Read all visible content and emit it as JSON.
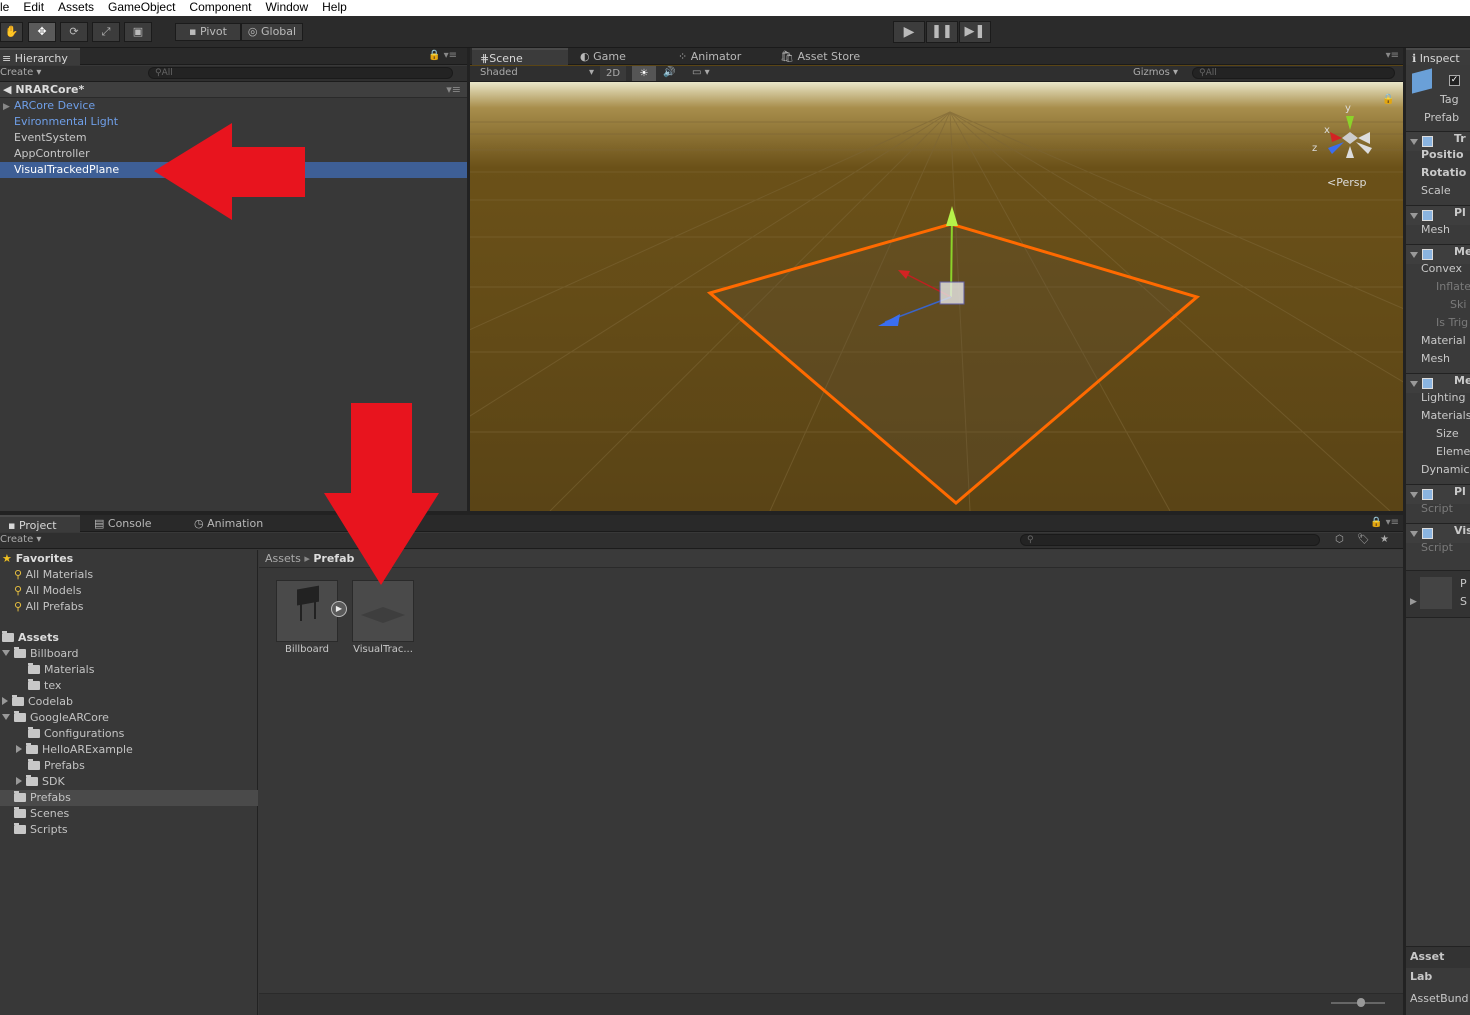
{
  "menu": [
    "le",
    "Edit",
    "Assets",
    "GameObject",
    "Component",
    "Window",
    "Help"
  ],
  "toolbar": {
    "pivot": "Pivot",
    "global": "Global"
  },
  "hierarchy": {
    "tab": "Hierarchy",
    "create": "Create",
    "search": "All",
    "scene": "NRARCore*",
    "items": [
      {
        "label": "ARCore Device",
        "prefab": true,
        "expand": true
      },
      {
        "label": "Evironmental Light",
        "prefab": true,
        "expand": false
      },
      {
        "label": "EventSystem",
        "prefab": false,
        "expand": false
      },
      {
        "label": "AppController",
        "prefab": false,
        "expand": false
      },
      {
        "label": "VisualTrackedPlane",
        "prefab": false,
        "expand": false,
        "selected": true
      }
    ]
  },
  "scene": {
    "tabs": [
      "Scene",
      "Game",
      "Animator",
      "Asset Store"
    ],
    "shading": "Shaded",
    "mode2d": "2D",
    "gizmos": "Gizmos",
    "search": "All",
    "persp": "Persp",
    "axis": {
      "x": "x",
      "y": "y",
      "z": "z"
    }
  },
  "project": {
    "tabs": [
      "Project",
      "Console",
      "Animation"
    ],
    "create": "Create",
    "favorites_title": "Favorites",
    "favorites": [
      "All Materials",
      "All Models",
      "All Prefabs"
    ],
    "assets_title": "Assets",
    "tree": [
      {
        "label": "Billboard",
        "indent": 1,
        "arrow": "down"
      },
      {
        "label": "Materials",
        "indent": 2,
        "arrow": ""
      },
      {
        "label": "tex",
        "indent": 2,
        "arrow": ""
      },
      {
        "label": "Codelab",
        "indent": 1,
        "arrow": "right"
      },
      {
        "label": "GoogleARCore",
        "indent": 1,
        "arrow": "down"
      },
      {
        "label": "Configurations",
        "indent": 2,
        "arrow": ""
      },
      {
        "label": "HelloARExample",
        "indent": 2,
        "arrow": "right"
      },
      {
        "label": "Prefabs",
        "indent": 2,
        "arrow": ""
      },
      {
        "label": "SDK",
        "indent": 2,
        "arrow": "right"
      },
      {
        "label": "Prefabs",
        "indent": 1,
        "arrow": "",
        "selected": true
      },
      {
        "label": "Scenes",
        "indent": 1,
        "arrow": ""
      },
      {
        "label": "Scripts",
        "indent": 1,
        "arrow": ""
      }
    ],
    "breadcrumb": {
      "root": "Assets",
      "sep": "▸",
      "current": "Prefab"
    },
    "assets": [
      {
        "label": "Billboard"
      },
      {
        "label": "VisualTrac..."
      }
    ]
  },
  "inspector": {
    "tab": "Inspect",
    "tag": "Tag",
    "prefab": "Prefab",
    "rows": [
      {
        "t": "Tr",
        "hdr": true
      },
      {
        "t": "Positio",
        "bold": true
      },
      {
        "t": "Rotatio",
        "bold": true
      },
      {
        "t": "Scale"
      },
      {
        "t": "Pl",
        "hdr": true
      },
      {
        "t": "Mesh"
      },
      {
        "t": "Me",
        "hdr": true
      },
      {
        "t": "Convex"
      },
      {
        "t": "Inflate",
        "dim": true
      },
      {
        "t": "Ski",
        "dim": true
      },
      {
        "t": "Is Trig",
        "dim": true
      },
      {
        "t": "Material"
      },
      {
        "t": "Mesh"
      },
      {
        "t": "Me",
        "hdr": true
      },
      {
        "t": "Lighting"
      },
      {
        "t": "Materials"
      },
      {
        "t": "Size"
      },
      {
        "t": "Eleme"
      },
      {
        "t": "Dynamic"
      },
      {
        "t": "Pl",
        "hdr": true
      },
      {
        "t": "Script",
        "dim": true
      },
      {
        "t": "Vis",
        "hdr": true
      },
      {
        "t": "Script",
        "dim": true
      }
    ],
    "preview": [
      "P",
      "S"
    ],
    "asset_labels": "Asset Lab",
    "asset_bundle": "AssetBund"
  },
  "colors": {
    "selection": "#3e5f96",
    "arrow": "#e8141e",
    "plane": "#ff6a00",
    "prefab_text": "#6f9fe8"
  }
}
